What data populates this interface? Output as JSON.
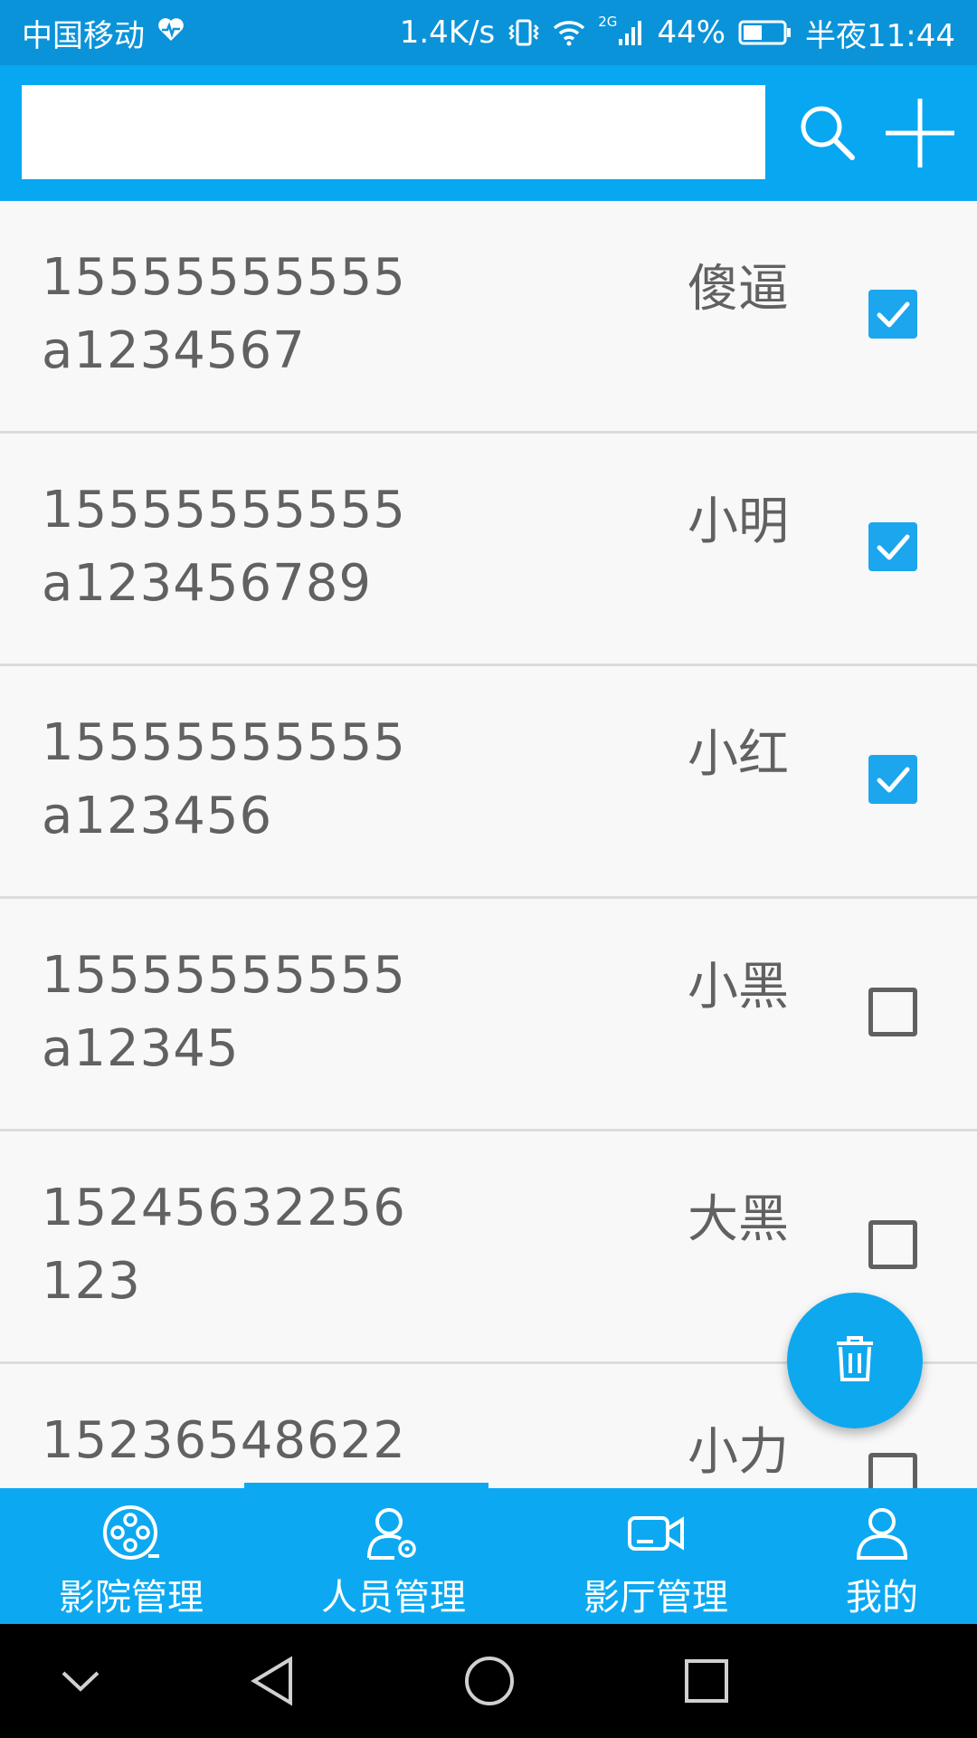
{
  "status_bar": {
    "carrier": "中国移动",
    "speed": "1.4K/s",
    "network": "2G",
    "battery": "44%",
    "time": "半夜11:44"
  },
  "search": {
    "value": "",
    "placeholder": ""
  },
  "rows": [
    {
      "phone": "15555555555",
      "password": "a1234567",
      "name": "傻逼",
      "checked": true
    },
    {
      "phone": "15555555555",
      "password": "a123456789",
      "name": "小明",
      "checked": true
    },
    {
      "phone": "15555555555",
      "password": "a123456",
      "name": "小红",
      "checked": true
    },
    {
      "phone": "15555555555",
      "password": "a12345",
      "name": "小黑",
      "checked": false
    },
    {
      "phone": "15245632256",
      "password": "123",
      "name": "大黑",
      "checked": false
    },
    {
      "phone": "15236548622",
      "password": "",
      "name": "小力",
      "checked": false
    }
  ],
  "bottom_nav": [
    {
      "label": "影院管理",
      "icon": "film-reel-icon"
    },
    {
      "label": "人员管理",
      "icon": "user-settings-icon",
      "active": true
    },
    {
      "label": "影厅管理",
      "icon": "video-camera-icon"
    },
    {
      "label": "我的",
      "icon": "person-icon"
    }
  ],
  "icons": {
    "search": "search-icon",
    "add": "plus-icon",
    "delete": "trash-icon"
  },
  "colors": {
    "status_bar": "#0b93d9",
    "app_bar": "#08a7f1",
    "accent": "#1ba6ee",
    "text": "#616161"
  }
}
